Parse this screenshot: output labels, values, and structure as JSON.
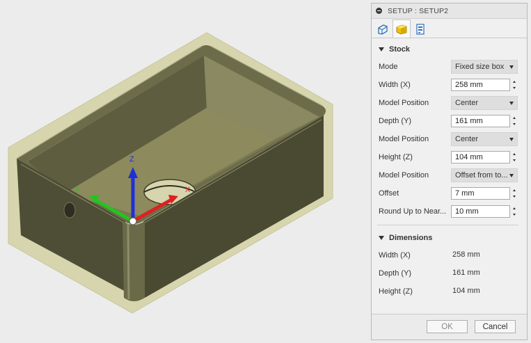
{
  "panel": {
    "title": "SETUP : SETUP2",
    "tabs": [
      {
        "icon": "setup-tool-icon"
      },
      {
        "icon": "stock-box-icon",
        "active": true
      },
      {
        "icon": "post-process-icon"
      }
    ],
    "stock": {
      "heading": "Stock",
      "rows": [
        {
          "label": "Mode",
          "type": "select",
          "value": "Fixed size box"
        },
        {
          "label": "Width (X)",
          "type": "number",
          "value": "258 mm"
        },
        {
          "label": "Model Position",
          "type": "select",
          "value": "Center"
        },
        {
          "label": "Depth (Y)",
          "type": "number",
          "value": "161 mm"
        },
        {
          "label": "Model Position",
          "type": "select",
          "value": "Center"
        },
        {
          "label": "Height (Z)",
          "type": "number",
          "value": "104 mm"
        },
        {
          "label": "Model Position",
          "type": "select",
          "value": "Offset from to..."
        },
        {
          "label": "Offset",
          "type": "number",
          "value": "7 mm"
        },
        {
          "label": "Round Up to Near...",
          "type": "number",
          "value": "10 mm"
        }
      ]
    },
    "dimensions": {
      "heading": "Dimensions",
      "rows": [
        {
          "label": "Width (X)",
          "value": "258 mm"
        },
        {
          "label": "Depth (Y)",
          "value": "161 mm"
        },
        {
          "label": "Height (Z)",
          "value": "104 mm"
        }
      ]
    },
    "buttons": {
      "ok": "OK",
      "cancel": "Cancel"
    }
  },
  "viewport": {
    "axis_labels": {
      "x": "X",
      "y": "Y",
      "z": "Z"
    },
    "colors": {
      "x_axis": "#e02020",
      "y_axis": "#22c51f",
      "z_axis": "#1f2fd6",
      "model": "#55553d",
      "stock": "#d9d8b2"
    }
  }
}
